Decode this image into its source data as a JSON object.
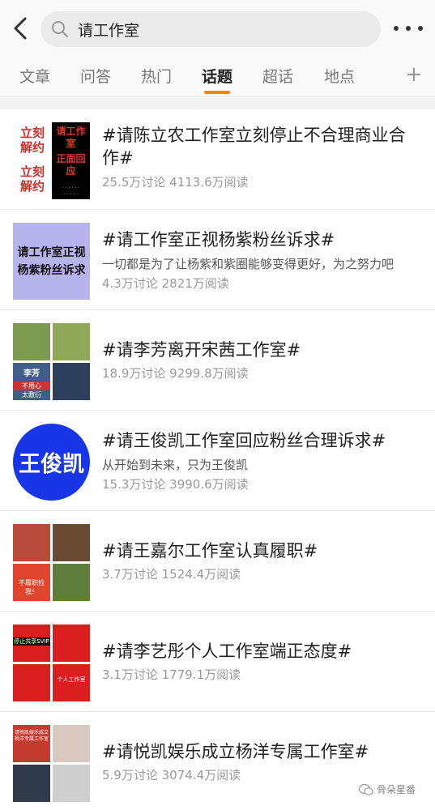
{
  "search": {
    "query": "请工作室"
  },
  "tabs": [
    "文章",
    "问答",
    "热门",
    "话题",
    "超话",
    "地点"
  ],
  "active_tab": "话题",
  "topics": [
    {
      "title": "#请陈立农工作室立刻停止不合理商业合作#",
      "desc": "",
      "stats": "25.5万讨论 4113.6万阅读",
      "thumb_text": {
        "left1": "立刻",
        "left2": "解约",
        "left3": "立刻",
        "left4": "解约",
        "right1": "请工作室",
        "right2": "正面回应"
      }
    },
    {
      "title": "#请工作室正视杨紫粉丝诉求#",
      "desc": "一切都是为了让杨紫和紫圈能够变得更好，为之努力吧",
      "stats": "4.3万讨论 2821万阅读",
      "thumb_text": {
        "line1": "请工作室正视",
        "line2": "杨紫粉丝诉求"
      }
    },
    {
      "title": "#请李芳离开宋茜工作室#",
      "desc": "",
      "stats": "18.9万讨论 9299.8万阅读",
      "thumb_text": {
        "name": "李芳",
        "tag": "不用心",
        "tag2": "太敷衍"
      }
    },
    {
      "title": "#请王俊凯工作室回应粉丝合理诉求#",
      "desc": "从开始到未来，只为王俊凯",
      "stats": "15.3万讨论 3990.6万阅读",
      "thumb_text": {
        "name": "王俊凯"
      }
    },
    {
      "title": "#请王嘉尔工作室认真履职#",
      "desc": "",
      "stats": "3.7万讨论 1524.4万阅读",
      "thumb_text": {
        "tag": "不履职捡我！"
      }
    },
    {
      "title": "#请李艺彤个人工作室端正态度#",
      "desc": "",
      "stats": "3.1万讨论 1779.1万阅读",
      "thumb_text": {
        "tag1": "停止共享SVIP",
        "tag2": "个人工作室"
      }
    },
    {
      "title": "#请悦凯娱乐成立杨洋专属工作室#",
      "desc": "",
      "stats": "5.9万讨论 3074.4万阅读",
      "thumb_text": {
        "tag": "请悦凯娱乐成立杨洋专属工作室"
      }
    }
  ],
  "watermark": "骨朵星番"
}
